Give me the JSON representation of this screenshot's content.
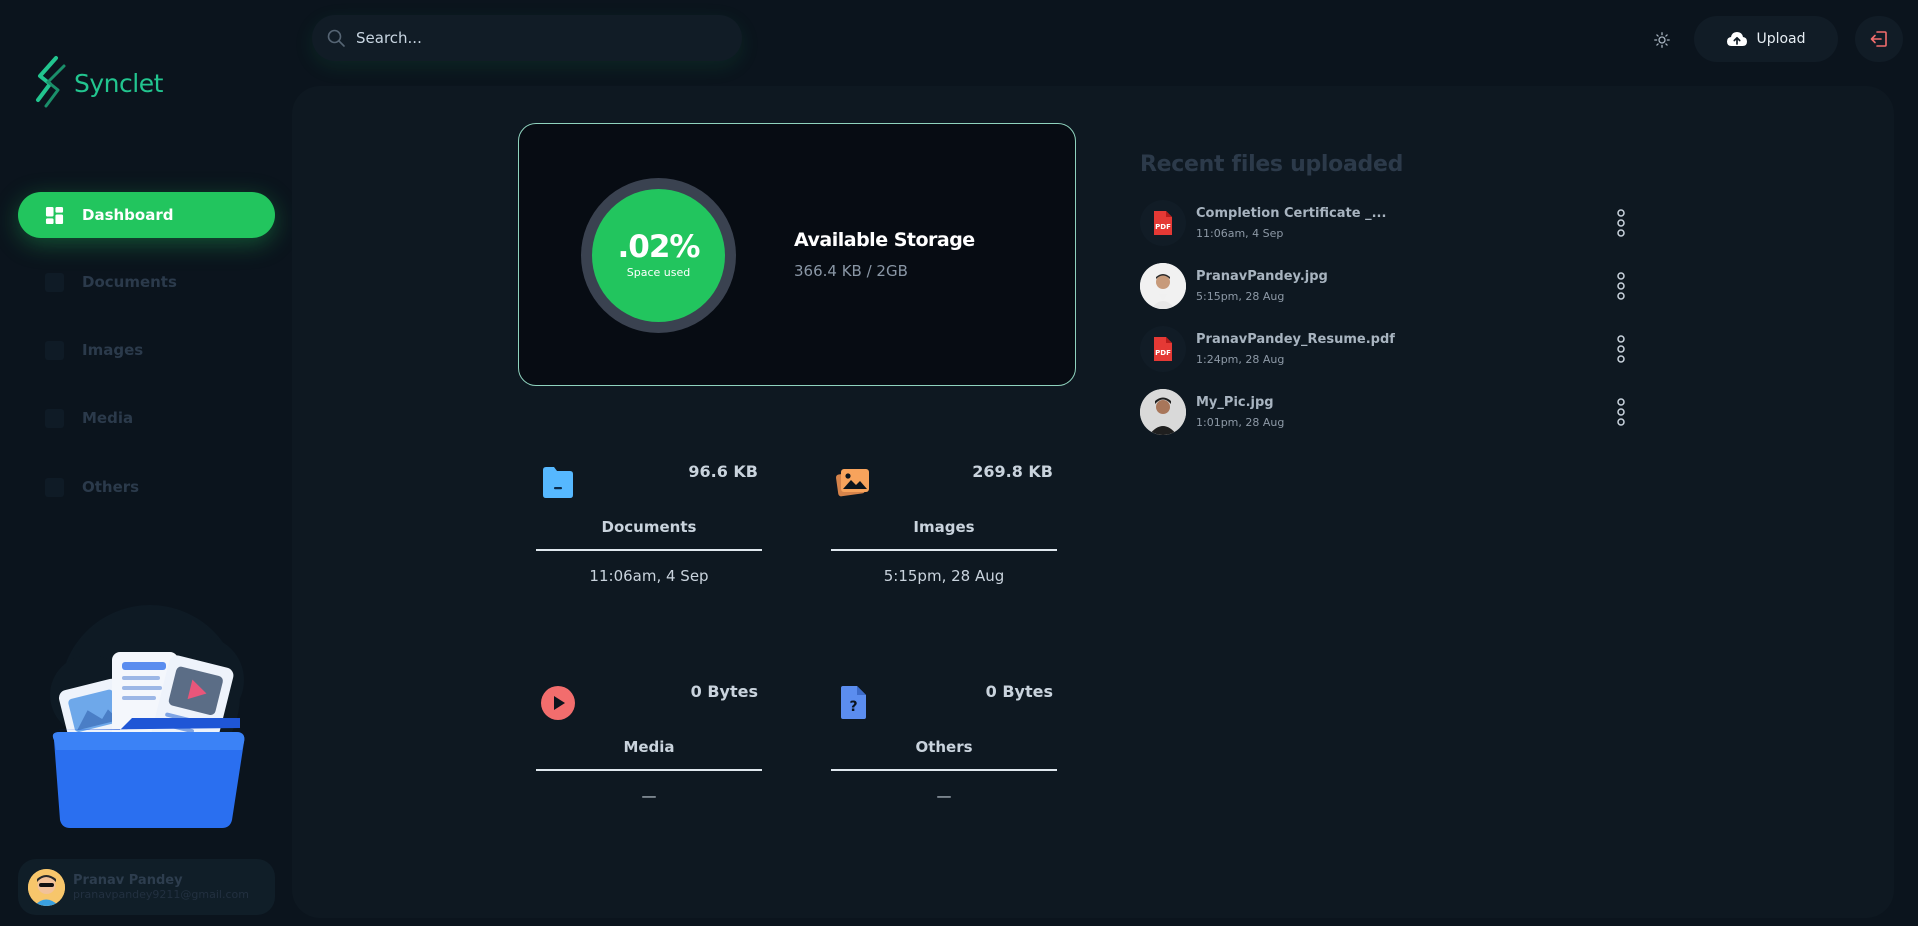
{
  "brand": {
    "name": "Synclet",
    "accent": "#22c55e"
  },
  "sidebar": {
    "items": [
      {
        "label": "Dashboard",
        "icon": "dashboard-grid-icon",
        "active": true
      },
      {
        "label": "Documents",
        "icon": "documents-icon",
        "active": false
      },
      {
        "label": "Images",
        "icon": "images-icon",
        "active": false
      },
      {
        "label": "Media",
        "icon": "media-icon",
        "active": false
      },
      {
        "label": "Others",
        "icon": "others-icon",
        "active": false
      }
    ],
    "illustration": "files-folder-illustration",
    "user": {
      "name": "Pranav Pandey",
      "email": "pranavpandey9211@gmail.com"
    }
  },
  "header": {
    "search_placeholder": "Search...",
    "theme_icon": "sun-icon",
    "upload_label": "Upload",
    "logout_icon": "logout-icon"
  },
  "storage": {
    "percent_label": ".02%",
    "percent_sub": "Space used",
    "title": "Available Storage",
    "value": "366.4 KB / 2GB"
  },
  "categories": [
    {
      "name": "Documents",
      "size": "96.6 KB",
      "date": "11:06am, 4 Sep",
      "icon": "folder-icon",
      "color": "#56b8ff"
    },
    {
      "name": "Images",
      "size": "269.8 KB",
      "date": "5:15pm, 28 Aug",
      "icon": "images-stack-icon",
      "color": "#f7a35c"
    },
    {
      "name": "Media",
      "size": "0 Bytes",
      "date": "—",
      "icon": "play-icon",
      "color": "#f26d6d"
    },
    {
      "name": "Others",
      "size": "0 Bytes",
      "date": "—",
      "icon": "unknown-file-icon",
      "color": "#5b8def"
    }
  ],
  "recent": {
    "title": "Recent files uploaded",
    "files": [
      {
        "name": "Completion Certificate _...",
        "time": "11:06am, 4 Sep",
        "type": "pdf"
      },
      {
        "name": "PranavPandey.jpg",
        "time": "5:15pm, 28 Aug",
        "type": "image"
      },
      {
        "name": "PranavPandey_Resume.pdf",
        "time": "1:24pm, 28 Aug",
        "type": "pdf"
      },
      {
        "name": "My_Pic.jpg",
        "time": "1:01pm, 28 Aug",
        "type": "image"
      }
    ]
  }
}
